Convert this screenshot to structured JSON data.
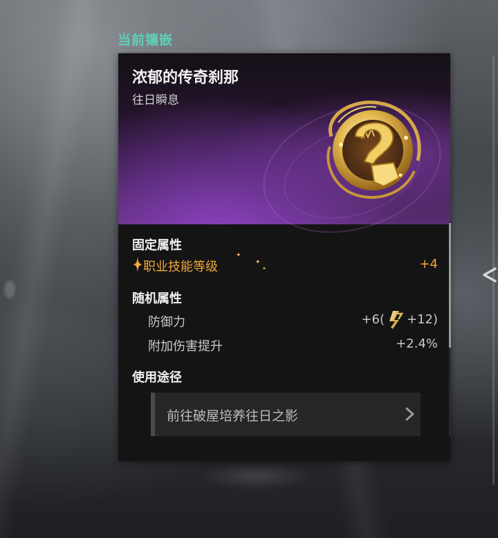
{
  "section": {
    "title": "当前镶嵌"
  },
  "item": {
    "name": "浓郁的传奇刹那",
    "subtitle": "往日瞬息"
  },
  "fixed_attributes": {
    "heading": "固定属性",
    "rows": [
      {
        "label": "职业技能等级",
        "value": "+4"
      }
    ]
  },
  "random_attributes": {
    "heading": "随机属性",
    "rows": [
      {
        "label": "防御力",
        "value_prefix": "+6(",
        "value_suffix": "+12)"
      },
      {
        "label": "附加伤害提升",
        "value": "+2.4%"
      }
    ]
  },
  "usage": {
    "heading": "使用途径",
    "link_label": "前往破屋培养往日之影"
  },
  "colors": {
    "accent_teal": "#5fd0b6",
    "fixed_orange": "#f2a93a",
    "header_purple": "#5a2e72"
  },
  "icons": {
    "emblem": "golden-broken-ring-emblem",
    "sparkle": "sparkle-icon",
    "bonus": "gold-chain-link-icon",
    "nav": "chevron-right-icon",
    "side": "chevron-left-icon"
  }
}
